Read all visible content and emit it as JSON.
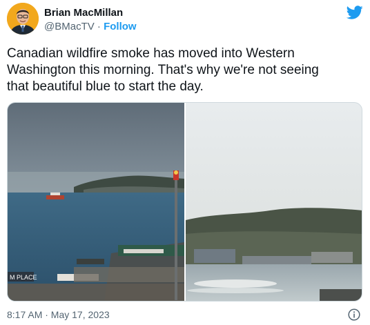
{
  "author": {
    "display_name": "Brian MacMillan",
    "handle": "@BMacTV",
    "separator": "·",
    "follow_label": "Follow"
  },
  "tweet": {
    "text": "Canadian wildfire smoke has moved into Western\nWashington this morning. That's why we're not seeing\nthat beautiful blue to start the day."
  },
  "media": {
    "left_photo_caption": "M PLACE"
  },
  "footer": {
    "timestamp": "8:17 AM · May 17, 2023"
  },
  "icons": {
    "brand": "twitter-bird-icon",
    "info": "info-icon"
  },
  "colors": {
    "accent": "#1d9bf0",
    "text": "#0f1419",
    "secondary": "#536471",
    "avatar_bg": "#f2a81d"
  }
}
